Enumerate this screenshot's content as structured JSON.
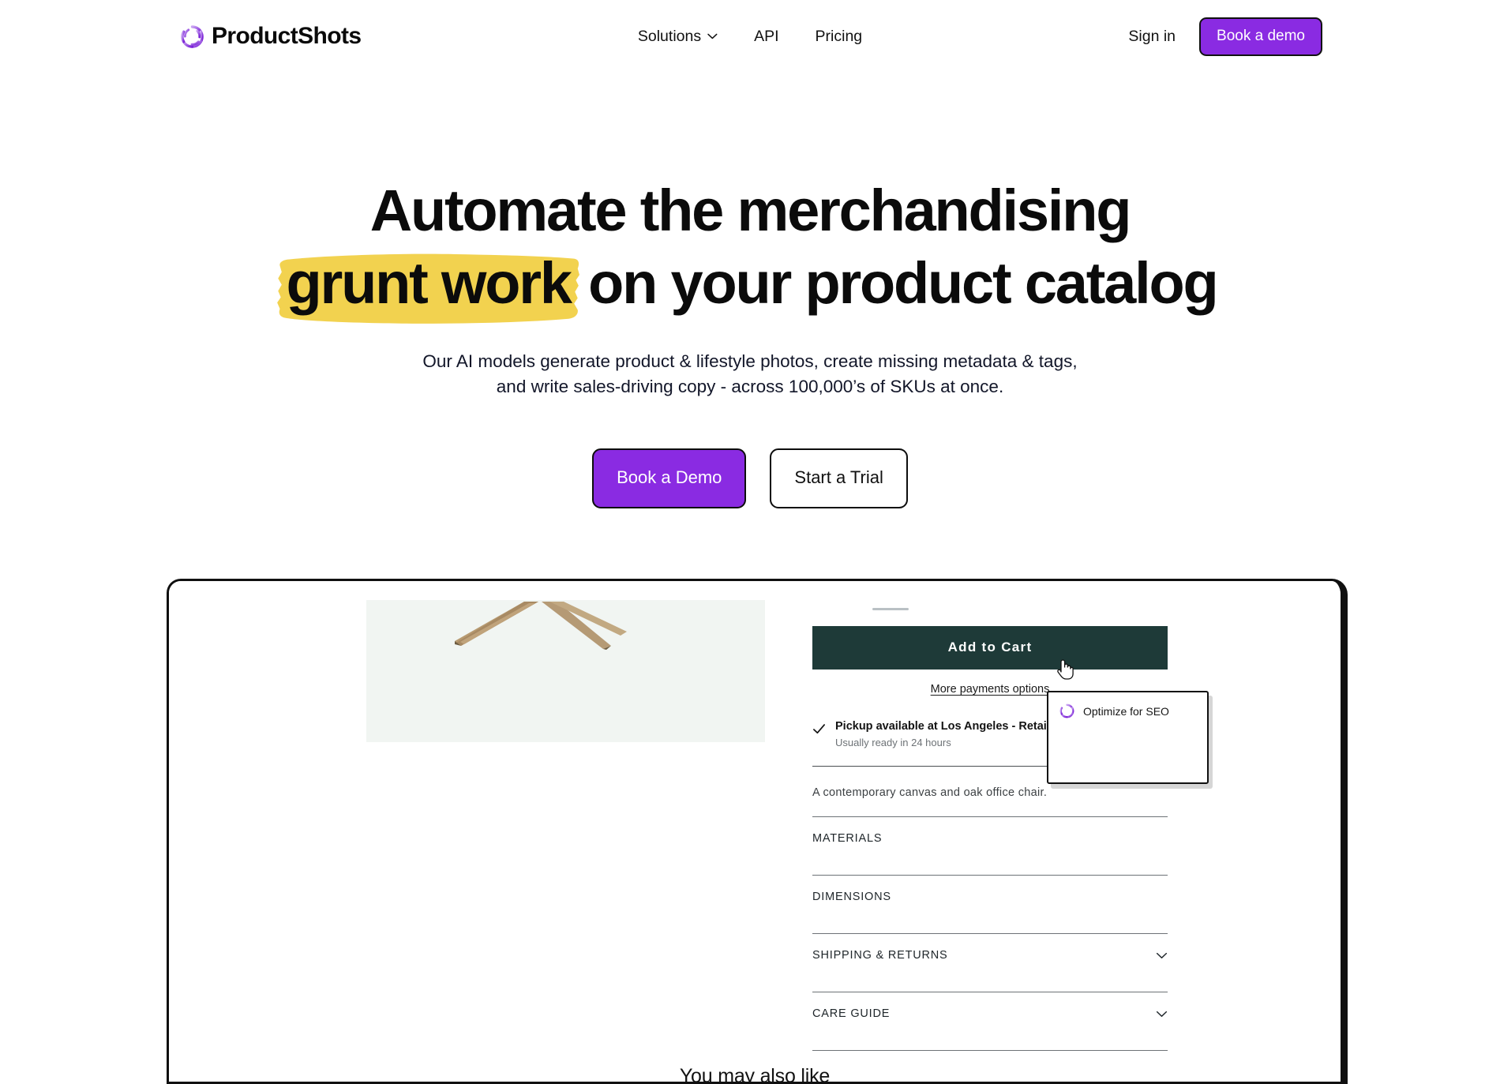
{
  "header": {
    "brand": {
      "name": "ProductShots",
      "icon": "aperture-icon"
    },
    "nav": [
      {
        "label": "Solutions",
        "has_chevron": true
      },
      {
        "label": "API",
        "has_chevron": false
      },
      {
        "label": "Pricing",
        "has_chevron": false
      }
    ],
    "sign_in": "Sign in",
    "demo_button": "Book a demo"
  },
  "hero": {
    "headline_line1": "Automate the merchandising",
    "headline_highlight": "grunt work",
    "headline_line2_rest": " on your product catalog",
    "highlight_color": "#F2D24F",
    "subhead_line1": "Our AI models generate product & lifestyle photos, create missing metadata & tags,",
    "subhead_line2": "and write sales-driving copy - across 100,000’s of SKUs at once.",
    "cta_primary": "Book a Demo",
    "cta_secondary": "Start a Trial",
    "accent_color": "#8A2BE2"
  },
  "mock": {
    "add_to_cart": "Add to Cart",
    "add_to_cart_color": "#1E3A38",
    "more_payments": "More payments options",
    "pickup_title": "Pickup available at Los Angeles - Retail Store",
    "pickup_sub": "Usually ready in 24 hours",
    "description": "A contemporary canvas and oak office chair.",
    "accordions": [
      {
        "label": "MATERIALS",
        "chevron": false
      },
      {
        "label": "DIMENSIONS",
        "chevron": false
      },
      {
        "label": "SHIPPING & RETURNS",
        "chevron": true
      },
      {
        "label": "CARE GUIDE",
        "chevron": true
      }
    ],
    "popup": {
      "item_label": "Optimize for SEO",
      "icon": "aperture-icon"
    },
    "also_like": "You may also like"
  }
}
